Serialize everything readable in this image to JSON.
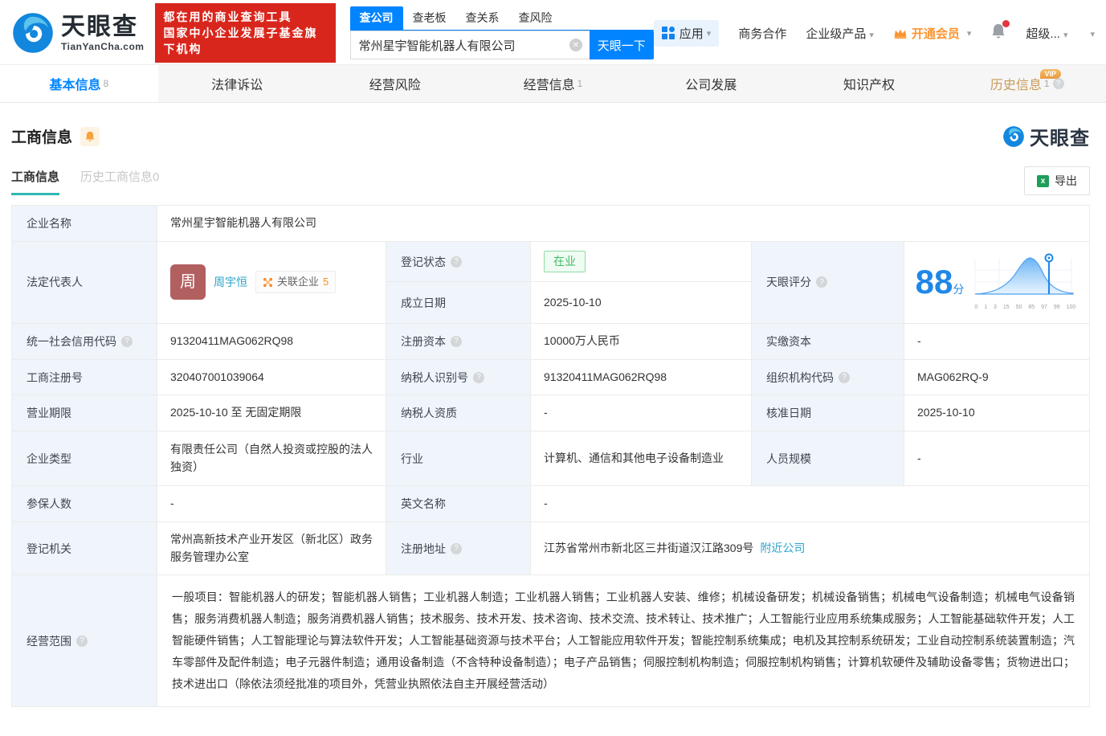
{
  "header": {
    "logo": {
      "title": "天眼查",
      "subtitle": "TianYanCha.com"
    },
    "slogan": {
      "line1": "都在用的商业查询工具",
      "line2": "国家中小企业发展子基金旗下机构"
    },
    "search": {
      "tabs": [
        {
          "label": "查公司"
        },
        {
          "label": "查老板"
        },
        {
          "label": "查关系"
        },
        {
          "label": "查风险"
        }
      ],
      "value": "常州星宇智能机器人有限公司",
      "button": "天眼一下"
    },
    "nav": {
      "apps": "应用",
      "business": "商务合作",
      "enterprise": "企业级产品",
      "vip": "开通会员",
      "user": "超级..."
    }
  },
  "tabs": [
    {
      "label": "基本信息",
      "count": "8"
    },
    {
      "label": "法律诉讼",
      "count": ""
    },
    {
      "label": "经营风险",
      "count": ""
    },
    {
      "label": "经营信息",
      "count": "1"
    },
    {
      "label": "公司发展",
      "count": ""
    },
    {
      "label": "知识产权",
      "count": ""
    },
    {
      "label": "历史信息",
      "count": "1",
      "vip": "VIP"
    }
  ],
  "section": {
    "title": "工商信息",
    "subtabs": [
      {
        "label": "工商信息"
      },
      {
        "label": "历史工商信息0"
      }
    ],
    "export_label": "导出",
    "watermark": "天眼查"
  },
  "table": {
    "company_name": {
      "label": "企业名称",
      "value": "常州星宇智能机器人有限公司"
    },
    "legal_rep": {
      "label": "法定代表人",
      "avatar": "周",
      "name": "周宇恒",
      "related_label": "关联企业",
      "related_count": "5"
    },
    "reg_status": {
      "label": "登记状态",
      "value": "在业"
    },
    "est_date": {
      "label": "成立日期",
      "value": "2025-10-10"
    },
    "score": {
      "label": "天眼评分",
      "value": "88",
      "unit": "分",
      "axis": [
        "0",
        "1",
        "3",
        "15",
        "50",
        "85",
        "97",
        "99",
        "100"
      ]
    },
    "credit_code": {
      "label": "统一社会信用代码",
      "value": "91320411MAG062RQ98"
    },
    "reg_capital": {
      "label": "注册资本",
      "value": "10000万人民币"
    },
    "paid_capital": {
      "label": "实缴资本",
      "value": "-"
    },
    "reg_number": {
      "label": "工商注册号",
      "value": "320407001039064"
    },
    "taxpayer_id": {
      "label": "纳税人识别号",
      "value": "91320411MAG062RQ98"
    },
    "org_code": {
      "label": "组织机构代码",
      "value": "MAG062RQ-9"
    },
    "business_term": {
      "label": "营业期限",
      "value": "2025-10-10 至 无固定期限"
    },
    "taxpayer_quality": {
      "label": "纳税人资质",
      "value": "-"
    },
    "approval_date": {
      "label": "核准日期",
      "value": "2025-10-10"
    },
    "company_type": {
      "label": "企业类型",
      "value": "有限责任公司（自然人投资或控股的法人独资）"
    },
    "industry": {
      "label": "行业",
      "value": "计算机、通信和其他电子设备制造业"
    },
    "staff_size": {
      "label": "人员规模",
      "value": "-"
    },
    "insured_count": {
      "label": "参保人数",
      "value": "-"
    },
    "english_name": {
      "label": "英文名称",
      "value": "-"
    },
    "reg_authority": {
      "label": "登记机关",
      "value": "常州高新技术产业开发区（新北区）政务服务管理办公室"
    },
    "reg_address": {
      "label": "注册地址",
      "value": "江苏省常州市新北区三井街道汉江路309号",
      "link": "附近公司"
    },
    "business_scope": {
      "label": "经营范围",
      "value": "一般项目：智能机器人的研发；智能机器人销售；工业机器人制造；工业机器人销售；工业机器人安装、维修；机械设备研发；机械设备销售；机械电气设备制造；机械电气设备销售；服务消费机器人制造；服务消费机器人销售；技术服务、技术开发、技术咨询、技术交流、技术转让、技术推广；人工智能行业应用系统集成服务；人工智能基础软件开发；人工智能硬件销售；人工智能理论与算法软件开发；人工智能基础资源与技术平台；人工智能应用软件开发；智能控制系统集成；电机及其控制系统研发；工业自动控制系统装置制造；汽车零部件及配件制造；电子元器件制造；通用设备制造（不含特种设备制造）；电子产品销售；伺服控制机构制造；伺服控制机构销售；计算机软硬件及辅助设备零售；货物进出口；技术进出口（除依法须经批准的项目外，凭营业执照依法自主开展经营活动）"
    }
  },
  "colors": {
    "brand_blue": "#0084ff",
    "link_teal": "#2ba3c9",
    "vip_orange": "#fb9531",
    "status_green": "#3dbd64",
    "slogan_red": "#d9261c"
  }
}
